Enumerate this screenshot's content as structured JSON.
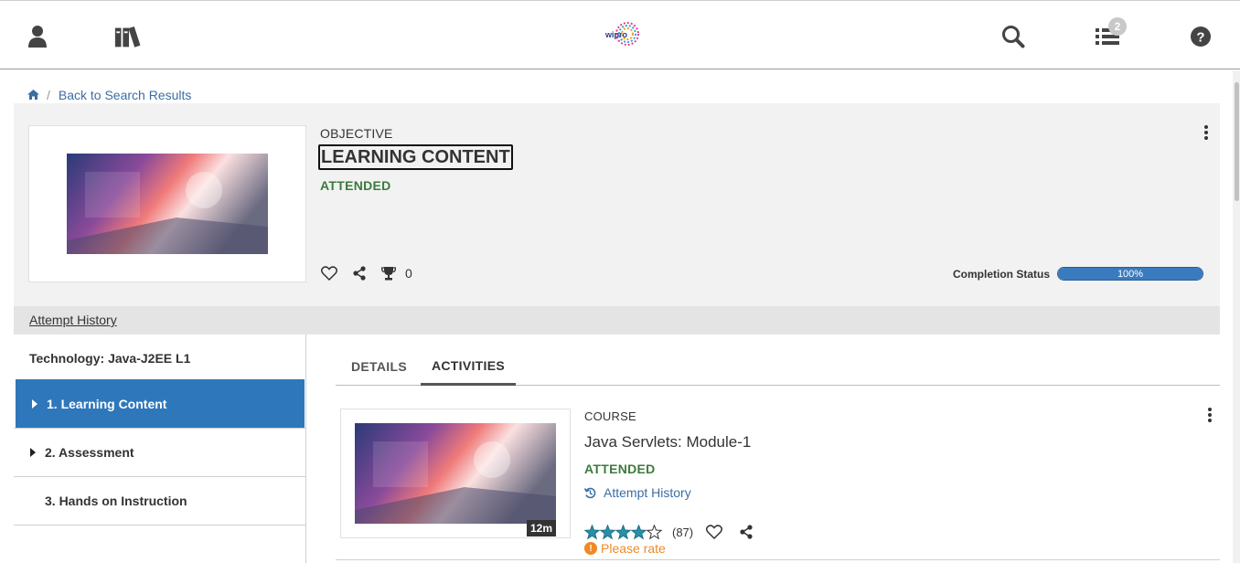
{
  "header": {
    "logo_text": "wipro",
    "badge_count": "2",
    "icons": [
      "user-icon",
      "library-icon",
      "search-icon",
      "list-icon",
      "help-icon"
    ]
  },
  "breadcrumb": {
    "home_icon": "home-icon",
    "back_label": "Back to Search Results"
  },
  "hero": {
    "type": "OBJECTIVE",
    "title": "LEARNING CONTENT",
    "status": "ATTENDED",
    "trophy_count": "0",
    "completion_label": "Completion Status",
    "completion_percent": "100%",
    "completion_value": 100
  },
  "attempt_history": "Attempt History",
  "sidebar": {
    "heading": "Technology: Java-J2EE L1",
    "items": [
      {
        "label": "1. Learning Content",
        "active": true
      },
      {
        "label": "2. Assessment",
        "active": false
      },
      {
        "label": "3. Hands on Instruction",
        "active": false
      }
    ]
  },
  "tabs": [
    {
      "label": "DETAILS",
      "active": false
    },
    {
      "label": "ACTIVITIES",
      "active": true
    }
  ],
  "activity": {
    "type": "COURSE",
    "title": "Java Servlets: Module-1",
    "status": "ATTENDED",
    "attempt_label": "Attempt History",
    "duration": "12m",
    "rating_stars": 4,
    "rating_count": "(87)",
    "please_rate": "Please rate"
  },
  "colors": {
    "accent_blue": "#2f77bb",
    "link_blue": "#3a6ea5",
    "attended_green": "#3c7a3c",
    "warning_orange": "#f08a24",
    "star_teal": "#2a8fa8"
  }
}
